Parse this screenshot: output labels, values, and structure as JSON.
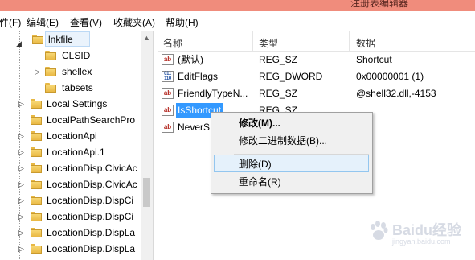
{
  "window": {
    "title": "注册表编辑器"
  },
  "menu": [
    "件(F)",
    "编辑(E)",
    "查看(V)",
    "收藏夹(A)",
    "帮助(H)"
  ],
  "tree": {
    "items": [
      {
        "label": "lnkfile",
        "selected": true
      },
      {
        "label": "CLSID"
      },
      {
        "label": "shellex"
      },
      {
        "label": "tabsets"
      },
      {
        "label": "Local Settings"
      },
      {
        "label": "LocalPathSearchPro"
      },
      {
        "label": "LocationApi"
      },
      {
        "label": "LocationApi.1"
      },
      {
        "label": "LocationDisp.CivicAc"
      },
      {
        "label": "LocationDisp.CivicAc"
      },
      {
        "label": "LocationDisp.DispCi"
      },
      {
        "label": "LocationDisp.DispCi"
      },
      {
        "label": "LocationDisp.DispLa"
      },
      {
        "label": "LocationDisp.DispLa"
      }
    ]
  },
  "list": {
    "headers": [
      "名称",
      "类型",
      "数据"
    ],
    "rows": [
      {
        "name": "(默认)",
        "type": "REG_SZ",
        "data": "Shortcut",
        "icon": "string-value-icon"
      },
      {
        "name": "EditFlags",
        "type": "REG_DWORD",
        "data": "0x00000001 (1)",
        "icon": "binary-value-icon"
      },
      {
        "name": "FriendlyTypeN...",
        "type": "REG_SZ",
        "data": "@shell32.dll,-4153",
        "icon": "string-value-icon"
      },
      {
        "name": "IsShortcut",
        "type": "REG_SZ",
        "data": "",
        "icon": "string-value-icon",
        "selected": true
      },
      {
        "name": "NeverS",
        "type": "",
        "data": "",
        "icon": "string-value-icon"
      }
    ]
  },
  "context_menu": {
    "items": [
      "修改(M)...",
      "修改二进制数据(B)...",
      "删除(D)",
      "重命名(R)"
    ],
    "highlighted": "删除(D)"
  },
  "watermark": {
    "line1": "Baidu经验",
    "line2": "jingyan.baidu.com"
  }
}
